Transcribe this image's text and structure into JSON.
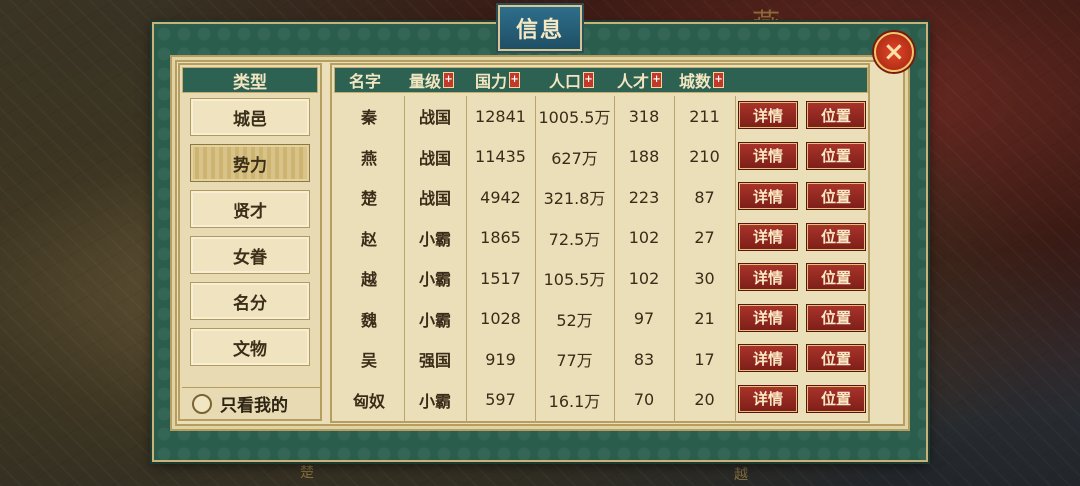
{
  "title": "信息",
  "close_label": "×",
  "map_labels": [
    "燕",
    "楚",
    "越"
  ],
  "sidebar": {
    "header": "类型",
    "items": [
      {
        "label": "城邑",
        "active": false
      },
      {
        "label": "势力",
        "active": true
      },
      {
        "label": "贤才",
        "active": false
      },
      {
        "label": "女眷",
        "active": false
      },
      {
        "label": "名分",
        "active": false
      },
      {
        "label": "文物",
        "active": false
      }
    ],
    "filter_label": "只看我的"
  },
  "table": {
    "columns": [
      {
        "label": "名字",
        "sortable": false
      },
      {
        "label": "量级",
        "sortable": true
      },
      {
        "label": "国力",
        "sortable": true
      },
      {
        "label": "人口",
        "sortable": true
      },
      {
        "label": "人才",
        "sortable": true
      },
      {
        "label": "城数",
        "sortable": true
      }
    ],
    "sort_icon": "+",
    "detail_label": "详情",
    "position_label": "位置",
    "rows": [
      {
        "name": "秦",
        "rank": "战国",
        "power": "12841",
        "population": "1005.5万",
        "talent": "318",
        "cities": "211"
      },
      {
        "name": "燕",
        "rank": "战国",
        "power": "11435",
        "population": "627万",
        "talent": "188",
        "cities": "210"
      },
      {
        "name": "楚",
        "rank": "战国",
        "power": "4942",
        "population": "321.8万",
        "talent": "223",
        "cities": "87"
      },
      {
        "name": "赵",
        "rank": "小霸",
        "power": "1865",
        "population": "72.5万",
        "talent": "102",
        "cities": "27"
      },
      {
        "name": "越",
        "rank": "小霸",
        "power": "1517",
        "population": "105.5万",
        "talent": "102",
        "cities": "30"
      },
      {
        "name": "魏",
        "rank": "小霸",
        "power": "1028",
        "population": "52万",
        "talent": "97",
        "cities": "21"
      },
      {
        "name": "吴",
        "rank": "强国",
        "power": "919",
        "population": "77万",
        "talent": "83",
        "cities": "17"
      },
      {
        "name": "匈奴",
        "rank": "小霸",
        "power": "597",
        "population": "16.1万",
        "talent": "70",
        "cities": "20"
      }
    ]
  },
  "colors": {
    "frame": "#2b5d4c",
    "parchment": "#ebdfb9",
    "header": "#2d6151",
    "button_red": "#a8332a",
    "gold_border": "#c9b27a"
  }
}
